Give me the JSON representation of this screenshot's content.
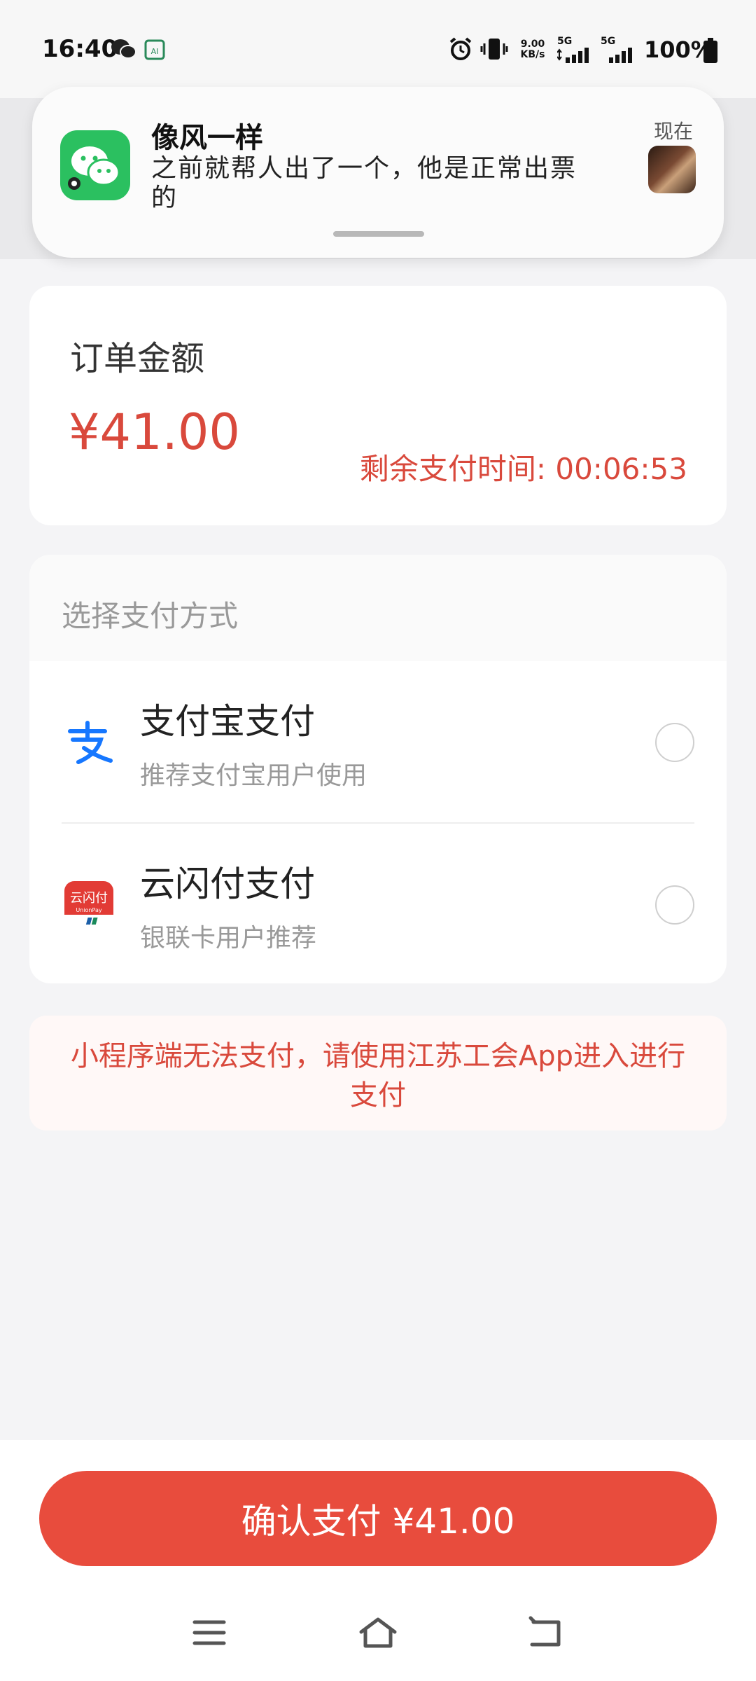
{
  "status_bar": {
    "time": "16:40",
    "net_speed_value": "9.00",
    "net_speed_unit": "KB/s",
    "signal1_label": "5G",
    "signal2_label": "5G",
    "battery_percent": "100%"
  },
  "notification": {
    "sender": "像风一样",
    "message": "之前就帮人出了一个，他是正常出票的",
    "time": "现在",
    "app_icon": "wechat-icon"
  },
  "order": {
    "label": "订单金额",
    "amount": "¥41.00",
    "timer": "剩余支付时间: 00:06:53"
  },
  "payment": {
    "header": "选择支付方式",
    "methods": [
      {
        "name": "支付宝支付",
        "desc": "推荐支付宝用户使用",
        "icon": "alipay-icon",
        "selected": false
      },
      {
        "name": "云闪付支付",
        "desc": "银联卡用户推荐",
        "icon": "unionpay-icon",
        "icon_text": "云闪付",
        "icon_subtext": "UnionPay",
        "selected": false
      }
    ]
  },
  "warning": {
    "text": "小程序端无法支付，请使用江苏工会App进入进行支付"
  },
  "confirm_button": {
    "label": "确认支付 ¥41.00"
  },
  "colors": {
    "accent": "#e84c3d",
    "price": "#d9493c",
    "wechat_green": "#2bc060",
    "alipay_blue": "#1677ff"
  }
}
